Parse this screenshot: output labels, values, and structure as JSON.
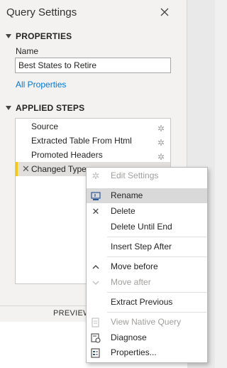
{
  "header": {
    "title": "Query Settings"
  },
  "properties": {
    "section_label": "PROPERTIES",
    "name_label": "Name",
    "name_value": "Best States to Retire",
    "all_properties_link": "All Properties"
  },
  "applied_steps": {
    "section_label": "APPLIED STEPS",
    "steps": [
      {
        "label": "Source",
        "has_gear": true
      },
      {
        "label": "Extracted Table From Html",
        "has_gear": true
      },
      {
        "label": "Promoted Headers",
        "has_gear": true
      },
      {
        "label": "Changed Type",
        "selected": true
      }
    ]
  },
  "preview_bar": {
    "label": "PREVIEW"
  },
  "context_menu": {
    "items": [
      {
        "label": "Edit Settings",
        "disabled": true,
        "icon": "gear-icon"
      },
      {
        "label": "Rename",
        "highlighted": true,
        "icon": "rename-icon"
      },
      {
        "label": "Delete",
        "icon": "close-icon"
      },
      {
        "label": "Delete Until End"
      },
      {
        "label": "Insert Step After"
      },
      {
        "label": "Move before",
        "icon": "chevron-up-icon"
      },
      {
        "label": "Move after",
        "disabled": true,
        "icon": "chevron-down-icon"
      },
      {
        "label": "Extract Previous"
      },
      {
        "label": "View Native Query",
        "disabled": true,
        "icon": "document-icon"
      },
      {
        "label": "Diagnose",
        "icon": "diagnose-icon"
      },
      {
        "label": "Properties...",
        "icon": "properties-icon"
      }
    ]
  }
}
